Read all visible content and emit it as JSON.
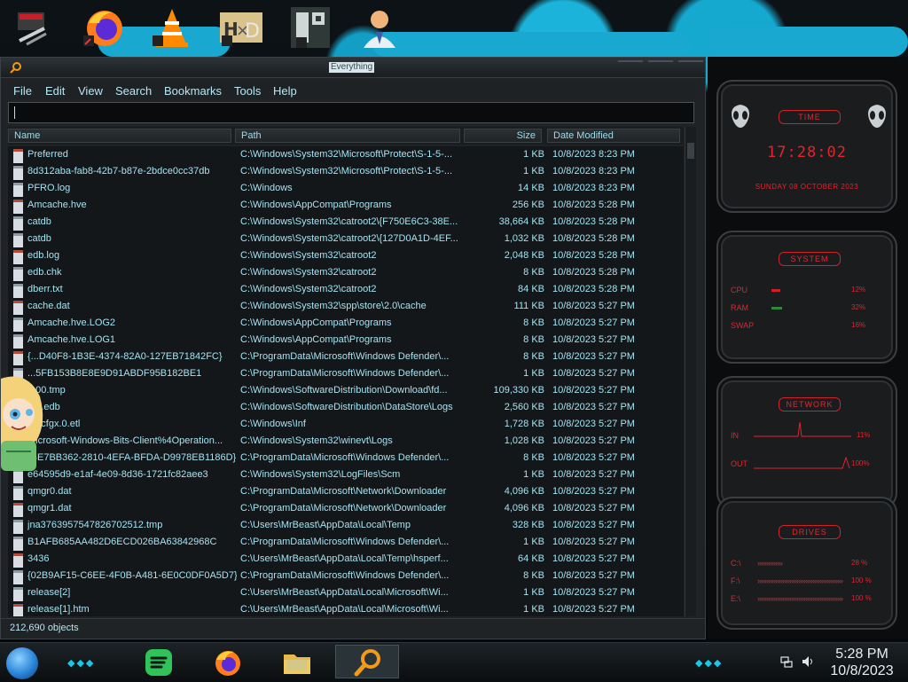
{
  "window": {
    "title": "Everything",
    "menu": [
      "File",
      "Edit",
      "View",
      "Search",
      "Bookmarks",
      "Tools",
      "Help"
    ],
    "search_value": "",
    "columns": {
      "name": "Name",
      "path": "Path",
      "size": "Size",
      "date": "Date Modified"
    },
    "rows": [
      {
        "name": "Preferred",
        "path": "C:\\Windows\\System32\\Microsoft\\Protect\\S-1-5-...",
        "size": "1 KB",
        "date": "10/8/2023 8:23 PM"
      },
      {
        "name": "8d312aba-fab8-42b7-b87e-2bdce0cc37db",
        "path": "C:\\Windows\\System32\\Microsoft\\Protect\\S-1-5-...",
        "size": "1 KB",
        "date": "10/8/2023 8:23 PM"
      },
      {
        "name": "PFRO.log",
        "path": "C:\\Windows",
        "size": "14 KB",
        "date": "10/8/2023 8:23 PM"
      },
      {
        "name": "Amcache.hve",
        "path": "C:\\Windows\\AppCompat\\Programs",
        "size": "256 KB",
        "date": "10/8/2023 5:28 PM"
      },
      {
        "name": "catdb",
        "path": "C:\\Windows\\System32\\catroot2\\{F750E6C3-38E...",
        "size": "38,664 KB",
        "date": "10/8/2023 5:28 PM"
      },
      {
        "name": "catdb",
        "path": "C:\\Windows\\System32\\catroot2\\{127D0A1D-4EF...",
        "size": "1,032 KB",
        "date": "10/8/2023 5:28 PM"
      },
      {
        "name": "edb.log",
        "path": "C:\\Windows\\System32\\catroot2",
        "size": "2,048 KB",
        "date": "10/8/2023 5:28 PM"
      },
      {
        "name": "edb.chk",
        "path": "C:\\Windows\\System32\\catroot2",
        "size": "8 KB",
        "date": "10/8/2023 5:28 PM"
      },
      {
        "name": "dberr.txt",
        "path": "C:\\Windows\\System32\\catroot2",
        "size": "84 KB",
        "date": "10/8/2023 5:28 PM"
      },
      {
        "name": "cache.dat",
        "path": "C:\\Windows\\System32\\spp\\store\\2.0\\cache",
        "size": "111 KB",
        "date": "10/8/2023 5:27 PM"
      },
      {
        "name": "Amcache.hve.LOG2",
        "path": "C:\\Windows\\AppCompat\\Programs",
        "size": "8 KB",
        "date": "10/8/2023 5:27 PM"
      },
      {
        "name": "Amcache.hve.LOG1",
        "path": "C:\\Windows\\AppCompat\\Programs",
        "size": "8 KB",
        "date": "10/8/2023 5:27 PM"
      },
      {
        "name": "{...D40F8-1B3E-4374-82A0-127EB71842FC}",
        "path": "C:\\ProgramData\\Microsoft\\Windows Defender\\...",
        "size": "8 KB",
        "date": "10/8/2023 5:27 PM"
      },
      {
        "name": "...5FB153B8E8E9D91ABDF95B182BE1",
        "path": "C:\\ProgramData\\Microsoft\\Windows Defender\\...",
        "size": "1 KB",
        "date": "10/8/2023 5:27 PM"
      },
      {
        "name": "...00.tmp",
        "path": "C:\\Windows\\SoftwareDistribution\\Download\\fd...",
        "size": "109,330 KB",
        "date": "10/8/2023 5:27 PM"
      },
      {
        "name": "...p.edb",
        "path": "C:\\Windows\\SoftwareDistribution\\DataStore\\Logs",
        "size": "2,560 KB",
        "date": "10/8/2023 5:27 PM"
      },
      {
        "name": "netcfgx.0.etl",
        "path": "C:\\Windows\\Inf",
        "size": "1,728 KB",
        "date": "10/8/2023 5:27 PM"
      },
      {
        "name": "Microsoft-Windows-Bits-Client%4Operation...",
        "path": "C:\\Windows\\System32\\winevt\\Logs",
        "size": "1,028 KB",
        "date": "10/8/2023 5:27 PM"
      },
      {
        "name": "{BE7BB362-2810-4EFA-BFDA-D9978EB1186D}",
        "path": "C:\\ProgramData\\Microsoft\\Windows Defender\\...",
        "size": "8 KB",
        "date": "10/8/2023 5:27 PM"
      },
      {
        "name": "e64595d9-e1af-4e09-8d36-1721fc82aee3",
        "path": "C:\\Windows\\System32\\LogFiles\\Scm",
        "size": "1 KB",
        "date": "10/8/2023 5:27 PM"
      },
      {
        "name": "qmgr0.dat",
        "path": "C:\\ProgramData\\Microsoft\\Network\\Downloader",
        "size": "4,096 KB",
        "date": "10/8/2023 5:27 PM"
      },
      {
        "name": "qmgr1.dat",
        "path": "C:\\ProgramData\\Microsoft\\Network\\Downloader",
        "size": "4,096 KB",
        "date": "10/8/2023 5:27 PM"
      },
      {
        "name": "jna3763957547826702512.tmp",
        "path": "C:\\Users\\MrBeast\\AppData\\Local\\Temp",
        "size": "328 KB",
        "date": "10/8/2023 5:27 PM"
      },
      {
        "name": "B1AFB685AA482D6ECD026BA63842968C",
        "path": "C:\\ProgramData\\Microsoft\\Windows Defender\\...",
        "size": "1 KB",
        "date": "10/8/2023 5:27 PM"
      },
      {
        "name": "3436",
        "path": "C:\\Users\\MrBeast\\AppData\\Local\\Temp\\hsperf...",
        "size": "64 KB",
        "date": "10/8/2023 5:27 PM"
      },
      {
        "name": "{02B9AF15-C6EE-4F0B-A481-6E0C0DF0A5D7}",
        "path": "C:\\ProgramData\\Microsoft\\Windows Defender\\...",
        "size": "8 KB",
        "date": "10/8/2023 5:27 PM"
      },
      {
        "name": "release[2]",
        "path": "C:\\Users\\MrBeast\\AppData\\Local\\Microsoft\\Wi...",
        "size": "1 KB",
        "date": "10/8/2023 5:27 PM"
      },
      {
        "name": "release[1].htm",
        "path": "C:\\Users\\MrBeast\\AppData\\Local\\Microsoft\\Wi...",
        "size": "1 KB",
        "date": "10/8/2023 5:27 PM"
      }
    ],
    "status": "212,690 objects"
  },
  "widgets": {
    "time": {
      "title": "TIME",
      "clock": "17:28:02",
      "date": "SUNDAY 08 OCTOBER 2023"
    },
    "system": {
      "title": "SYSTEM",
      "rows": [
        {
          "label": "CPU",
          "value": "12%"
        },
        {
          "label": "RAM",
          "value": "32%"
        },
        {
          "label": "SWAP",
          "value": "16%"
        }
      ]
    },
    "network": {
      "title": "NETWORK",
      "rows": [
        {
          "label": "IN",
          "value": "11%"
        },
        {
          "label": "OUT",
          "value": "100%"
        }
      ]
    },
    "drives": {
      "title": "DRIVES",
      "rows": [
        {
          "label": "C:\\",
          "value": "28 %"
        },
        {
          "label": "F:\\",
          "value": "100 %"
        },
        {
          "label": "E:\\",
          "value": "100 %"
        }
      ]
    }
  },
  "taskbar": {
    "time": "5:28 PM",
    "date": "10/8/2023"
  },
  "icons": [
    "firefox-icon",
    "vlc-icon",
    "hxd-icon",
    "folder-icon",
    "everything-search-icon",
    "spotify-icon",
    "network-icon",
    "volume-icon"
  ],
  "colors": {
    "accent": "#a5e3f2",
    "widget_red": "#e3242c",
    "wallpaper_blue": "#19a8cf"
  }
}
